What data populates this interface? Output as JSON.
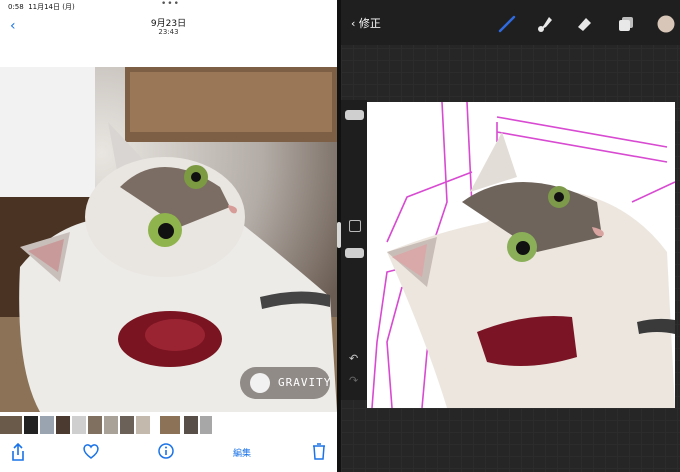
{
  "status_bar": {
    "time": "0:58",
    "date": "11月14日 (月)"
  },
  "photos": {
    "header": {
      "date": "9月23日",
      "time": "23:43"
    },
    "watermark": "GRAVITY",
    "toolbar": {
      "edit_label": "編集"
    }
  },
  "procreate": {
    "back_label": "修正",
    "brush_color": "#2f6ae0",
    "selected_color": "#d8c7b8"
  }
}
